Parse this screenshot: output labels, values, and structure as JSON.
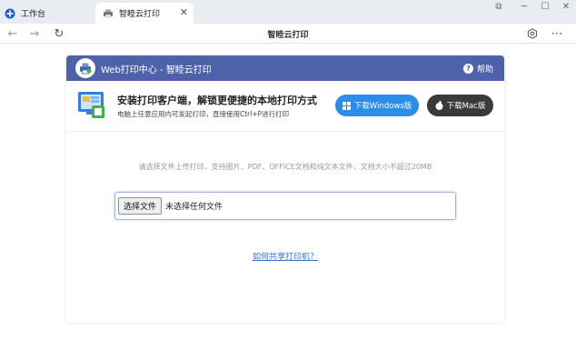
{
  "browser": {
    "tabs": [
      {
        "label": "工作台",
        "active": false
      },
      {
        "label": "智睦云打印",
        "active": true
      }
    ],
    "address_title": "智睦云打印"
  },
  "header": {
    "title": "Web打印中心 - 智睦云打印",
    "help_label": "帮助",
    "color": "#4e62ab"
  },
  "promo": {
    "title": "安装打印客户端，解锁更便捷的本地打印方式",
    "subtitle": "电脑上任意应用内可发起打印，直接使用Ctrl+P进行打印",
    "windows_button": "下载Windows版",
    "mac_button": "下载Mac版"
  },
  "upload": {
    "hint": "请选择文件上传打印，支持图片、PDF、OFFICE文档和纯文本文件，文档大小不超过20MB",
    "choose_button": "选择文件",
    "status": "未选择任何文件"
  },
  "share_link": "如何共享打印机？"
}
